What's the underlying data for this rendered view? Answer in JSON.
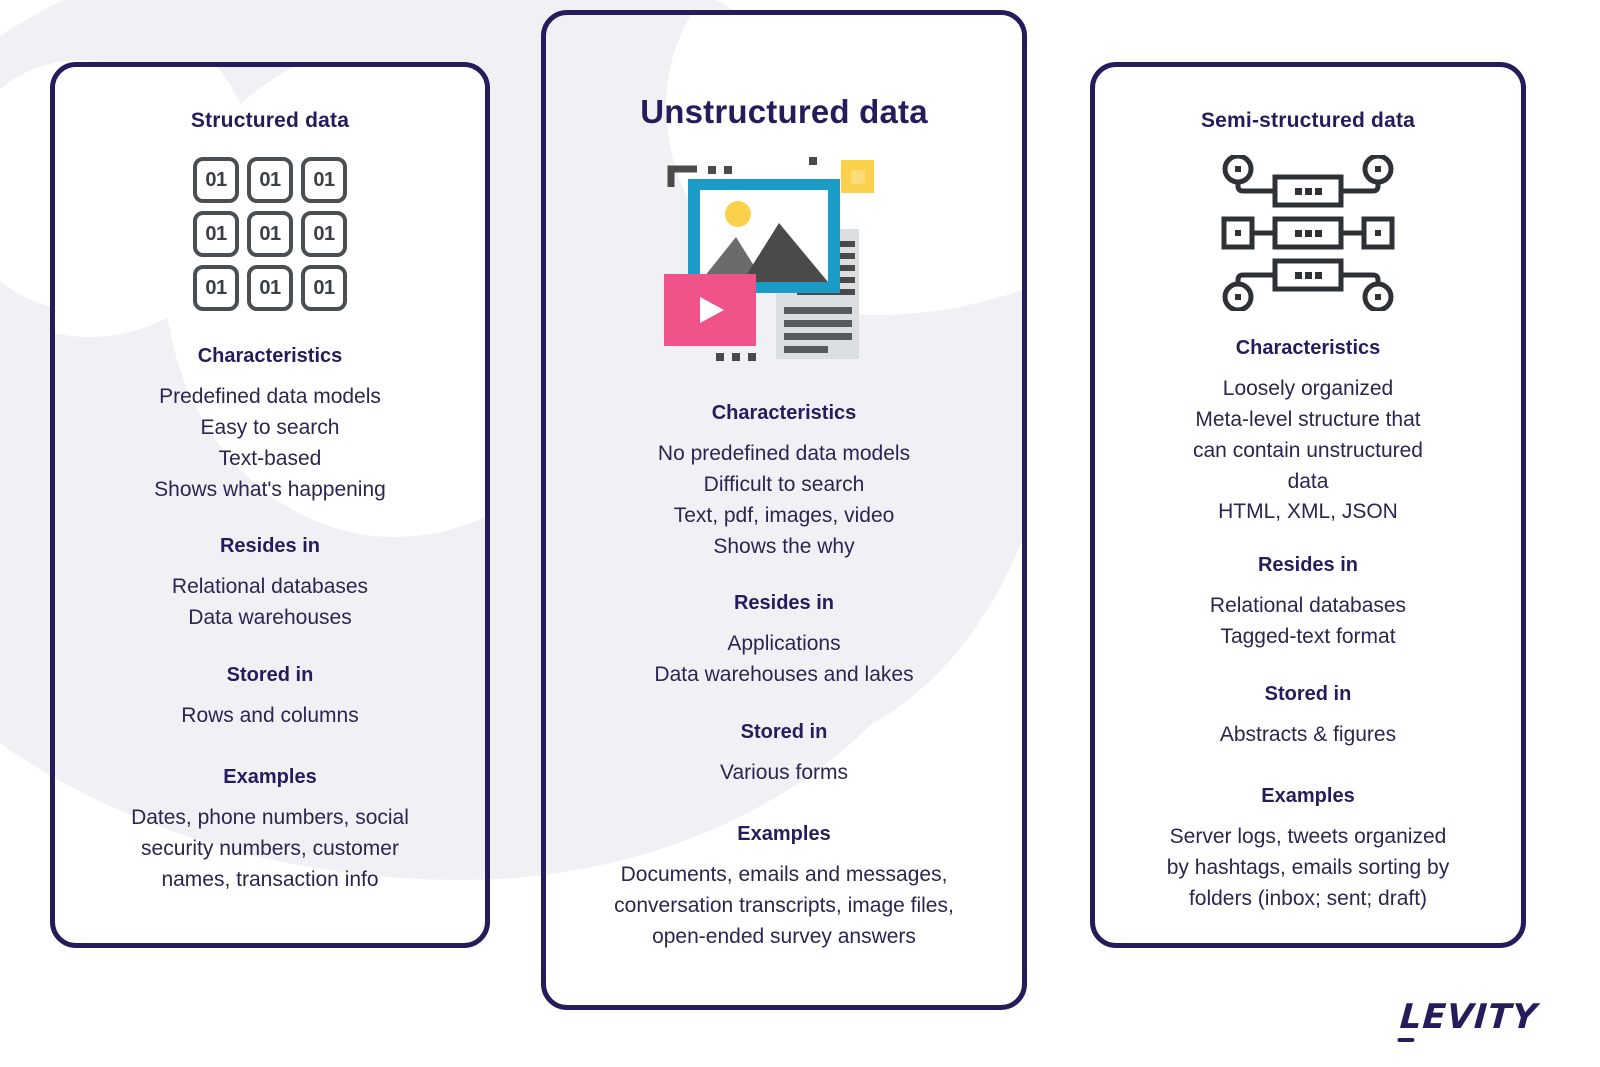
{
  "title": "Structured vs Unstructured vs Semi-structured data",
  "colors": {
    "card_border": "#261c5c",
    "heading": "#261c5c",
    "body_text": "#2b2550",
    "background": "#ffffff",
    "blob": "#f1f1f5",
    "icon_gray": "#4a4f54",
    "illus_blue": "#1a9cc7",
    "illus_pink": "#f0528a",
    "illus_yellow": "#fbd14b",
    "illus_dark_gray": "#4a4a4a",
    "illus_mid_gray": "#6b6b6b",
    "illus_light_gray": "#dcdfe2"
  },
  "cards": [
    {
      "id": "structured",
      "title": "Structured data",
      "icon": "binary-grid-icon",
      "icon_cells": [
        "01",
        "01",
        "01",
        "01",
        "01",
        "01",
        "01",
        "01",
        "01"
      ],
      "sections": [
        {
          "heading": "Characteristics",
          "lines": [
            "Predefined data models",
            "Easy to search",
            "Text-based",
            "Shows what's happening"
          ]
        },
        {
          "heading": "Resides in",
          "lines": [
            "Relational databases",
            "Data warehouses"
          ]
        },
        {
          "heading": "Stored in",
          "lines": [
            "Rows and columns"
          ]
        },
        {
          "heading": "Examples",
          "lines": [
            "Dates, phone numbers, social",
            "security numbers, customer",
            "names, transaction info"
          ]
        }
      ]
    },
    {
      "id": "unstructured",
      "title": "Unstructured data",
      "icon": "media-files-illustration",
      "sections": [
        {
          "heading": "Characteristics",
          "lines": [
            "No predefined data models",
            "Difficult to search",
            "Text, pdf, images, video",
            "Shows the why"
          ]
        },
        {
          "heading": "Resides in",
          "lines": [
            "Applications",
            "Data warehouses and lakes"
          ]
        },
        {
          "heading": "Stored in",
          "lines": [
            "Various forms"
          ]
        },
        {
          "heading": "Examples",
          "lines": [
            "Documents, emails and messages,",
            "conversation transcripts, image files,",
            "open-ended survey answers"
          ]
        }
      ]
    },
    {
      "id": "semi",
      "title": "Semi-structured data",
      "icon": "network-nodes-icon",
      "sections": [
        {
          "heading": "Characteristics",
          "lines": [
            "Loosely organized",
            "Meta-level structure that",
            "can contain unstructured",
            "data",
            "HTML, XML, JSON"
          ]
        },
        {
          "heading": "Resides in",
          "lines": [
            "Relational databases",
            "Tagged-text format"
          ]
        },
        {
          "heading": "Stored in",
          "lines": [
            "Abstracts  & figures"
          ]
        },
        {
          "heading": "Examples",
          "lines": [
            "Server logs, tweets organized",
            "by hashtags,  emails sorting by",
            "folders (inbox; sent; draft)"
          ]
        }
      ]
    }
  ],
  "logo": {
    "first_letter": "L",
    "rest": "EVITY",
    "full": "LEVITY"
  }
}
